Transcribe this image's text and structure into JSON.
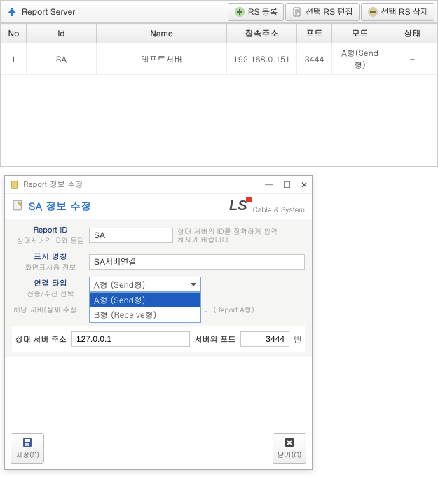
{
  "panel": {
    "title": "Report Server",
    "toolbar": {
      "register": "RS 등록",
      "edit": "선택 RS 편집",
      "delete": "선택 RS 삭제"
    },
    "columns": {
      "no": "No",
      "id": "id",
      "name": "Name",
      "addr": "접속주소",
      "port": "포트",
      "mode": "모드",
      "status": "상태"
    },
    "rows": [
      {
        "no": "1",
        "id": "SA",
        "name": "레포트서버",
        "addr": "192.168.0.151",
        "port": "3444",
        "mode": "A형(Send형)",
        "status": "–"
      }
    ]
  },
  "dialog": {
    "window_title": "Report 정보 수정",
    "header": "SA 정보 수정",
    "brand": {
      "ls": "LS",
      "sub": "Cable & System"
    },
    "fields": {
      "report_id": {
        "l1": "Report ID",
        "l2": "상대서버의 ID와 동일",
        "value": "SA",
        "hint": "상대 서버의 ID를 정확하게 입력 하시기 바랍니다"
      },
      "display_name": {
        "l1": "표시 명칭",
        "l2": "화면표시용 정보",
        "value": "SA서버연결"
      },
      "conn_type": {
        "l1": "연결 타입",
        "l2": "전송/수신 선택",
        "selected": "A형 (Send형)",
        "options": [
          "A형 (Send형)",
          "B형 (Receive형)"
        ]
      },
      "note_prefix": "해당 서버(실제 수집",
      "note_suffix": "속하여 연계 합니다. (Report A형)",
      "peer_addr": {
        "label": "상대 서버 주소",
        "value": "127.0.0.1"
      },
      "peer_port": {
        "label": "서버의 포트",
        "value": "3444",
        "suffix": "번"
      }
    },
    "buttons": {
      "save": "저장(S)",
      "close": "닫기(C)"
    }
  }
}
